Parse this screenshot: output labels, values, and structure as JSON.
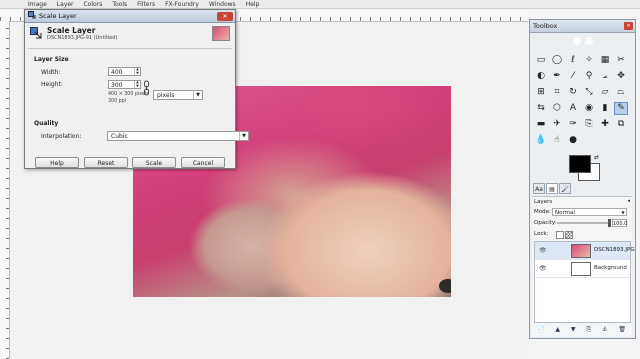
{
  "menubar": {
    "items": [
      "Image",
      "Layer",
      "Colors",
      "Tools",
      "Filters",
      "FX-Foundry",
      "Windows",
      "Help"
    ]
  },
  "dialog": {
    "window_title": "Scale Layer",
    "close_label": "✕",
    "header_title": "Scale Layer",
    "header_subtitle": "DSCN1893.JPG-91 (Untitled)",
    "layer_size_label": "Layer Size",
    "width_label": "Width:",
    "width_value": "400",
    "height_label": "Height:",
    "height_value": "300",
    "unit": "pixels",
    "size_info": "400 × 300 pixels",
    "resolution_info": "300 ppi",
    "quality_label": "Quality",
    "interpolation_label": "Interpolation:",
    "interpolation_value": "Cubic",
    "buttons": {
      "help": "Help",
      "reset": "Reset",
      "scale": "Scale",
      "cancel": "Cancel"
    }
  },
  "toolbox": {
    "title": "Toolbox",
    "close_label": "✕",
    "tools": [
      {
        "name": "rect-select",
        "glyph": "▭"
      },
      {
        "name": "ellipse-select",
        "glyph": "◯"
      },
      {
        "name": "free-select",
        "glyph": "ℓ"
      },
      {
        "name": "fuzzy-select",
        "glyph": "✧"
      },
      {
        "name": "color-select",
        "glyph": "▦"
      },
      {
        "name": "scissors-select",
        "glyph": "✂"
      },
      {
        "name": "foreground-select",
        "glyph": "◐"
      },
      {
        "name": "paths",
        "glyph": "✒"
      },
      {
        "name": "color-picker",
        "glyph": "⁄"
      },
      {
        "name": "zoom",
        "glyph": "⚲"
      },
      {
        "name": "measure",
        "glyph": "⦟"
      },
      {
        "name": "move",
        "glyph": "✥"
      },
      {
        "name": "align",
        "glyph": "⊞"
      },
      {
        "name": "crop",
        "glyph": "⌗"
      },
      {
        "name": "rotate",
        "glyph": "↻"
      },
      {
        "name": "scale",
        "glyph": "⤡"
      },
      {
        "name": "shear",
        "glyph": "▱"
      },
      {
        "name": "perspective",
        "glyph": "⏢"
      },
      {
        "name": "flip",
        "glyph": "⇆"
      },
      {
        "name": "cage",
        "glyph": "⬡"
      },
      {
        "name": "text",
        "glyph": "A"
      },
      {
        "name": "bucket-fill",
        "glyph": "◉"
      },
      {
        "name": "blend",
        "glyph": "▮"
      },
      {
        "name": "pencil",
        "glyph": "✎"
      },
      {
        "name": "eraser",
        "glyph": "▬"
      },
      {
        "name": "airbrush",
        "glyph": "✈"
      },
      {
        "name": "ink",
        "glyph": "✑"
      },
      {
        "name": "clone",
        "glyph": "⎘"
      },
      {
        "name": "heal",
        "glyph": "✚"
      },
      {
        "name": "perspective-clone",
        "glyph": "⧉"
      },
      {
        "name": "blur",
        "glyph": "💧"
      },
      {
        "name": "smudge",
        "glyph": "☝"
      },
      {
        "name": "dodge-burn",
        "glyph": "●"
      }
    ],
    "active_tool_index": 23,
    "swap_glyph": "⇄",
    "tabs": [
      "Aa",
      "▤",
      "🖌"
    ],
    "layers": {
      "header": "Layers",
      "header_arrow": "◂",
      "mode_label": "Mode:",
      "mode_value": "Normal",
      "opacity_label": "Opacity:",
      "opacity_value": "100.0",
      "opacity_fraction": 1.0,
      "lock_label": "Lock:",
      "items": [
        {
          "name": "DSCN1893.JPG",
          "visible_glyph": "👁",
          "selected": true
        },
        {
          "name": "Background",
          "visible_glyph": "👁",
          "selected": false
        }
      ],
      "bottom_buttons": [
        "📄",
        "▲",
        "▼",
        "⎘",
        "⚓",
        "🗑"
      ]
    }
  },
  "colors": {
    "accent": "#d94a7e",
    "foreground": "#000000",
    "background": "#ffffff"
  }
}
